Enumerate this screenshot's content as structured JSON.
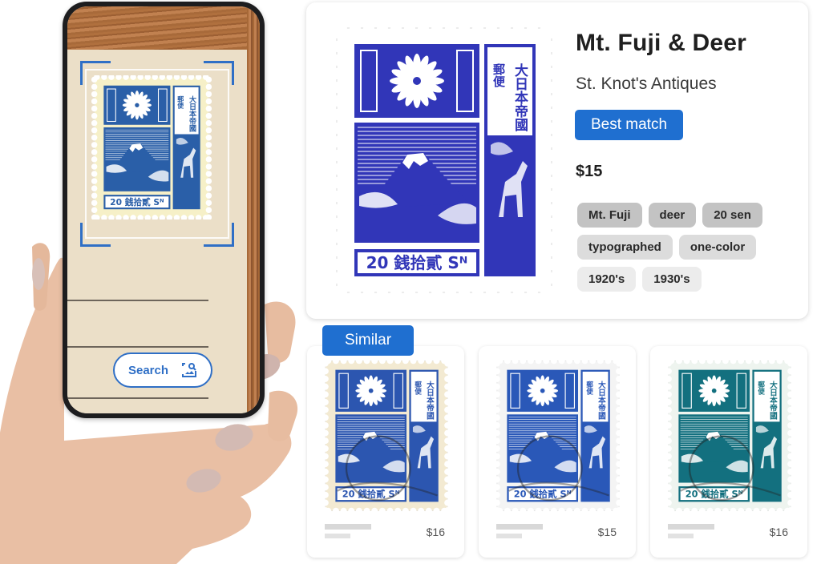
{
  "phone": {
    "search_button_label": "Search",
    "search_icon": "image-search-icon",
    "scan_frame": "viewfinder-corners"
  },
  "result": {
    "title": "Mt. Fuji & Deer",
    "seller": "St. Knot's Antiques",
    "badge": "Best match",
    "price": "$15",
    "tags": [
      [
        "Mt. Fuji",
        "deer",
        "20 sen"
      ],
      [
        "typographed",
        "one-color"
      ],
      [
        "1920's",
        "1930's"
      ]
    ],
    "stamp": {
      "denomination": "20",
      "caption": "20 銭拾貳 Sᴺ",
      "header_text": "大日本帝國",
      "side_text": "郵便"
    }
  },
  "similar": {
    "label": "Similar",
    "items": [
      {
        "price": "$16",
        "color": "#2c56b0"
      },
      {
        "price": "$15",
        "color": "#2a58b8"
      },
      {
        "price": "$16",
        "color": "#13707f"
      }
    ]
  },
  "colors": {
    "accent": "#1f6fd0",
    "stamp_main": "#3136b8",
    "stamp_phone": "#2a5fa8"
  }
}
